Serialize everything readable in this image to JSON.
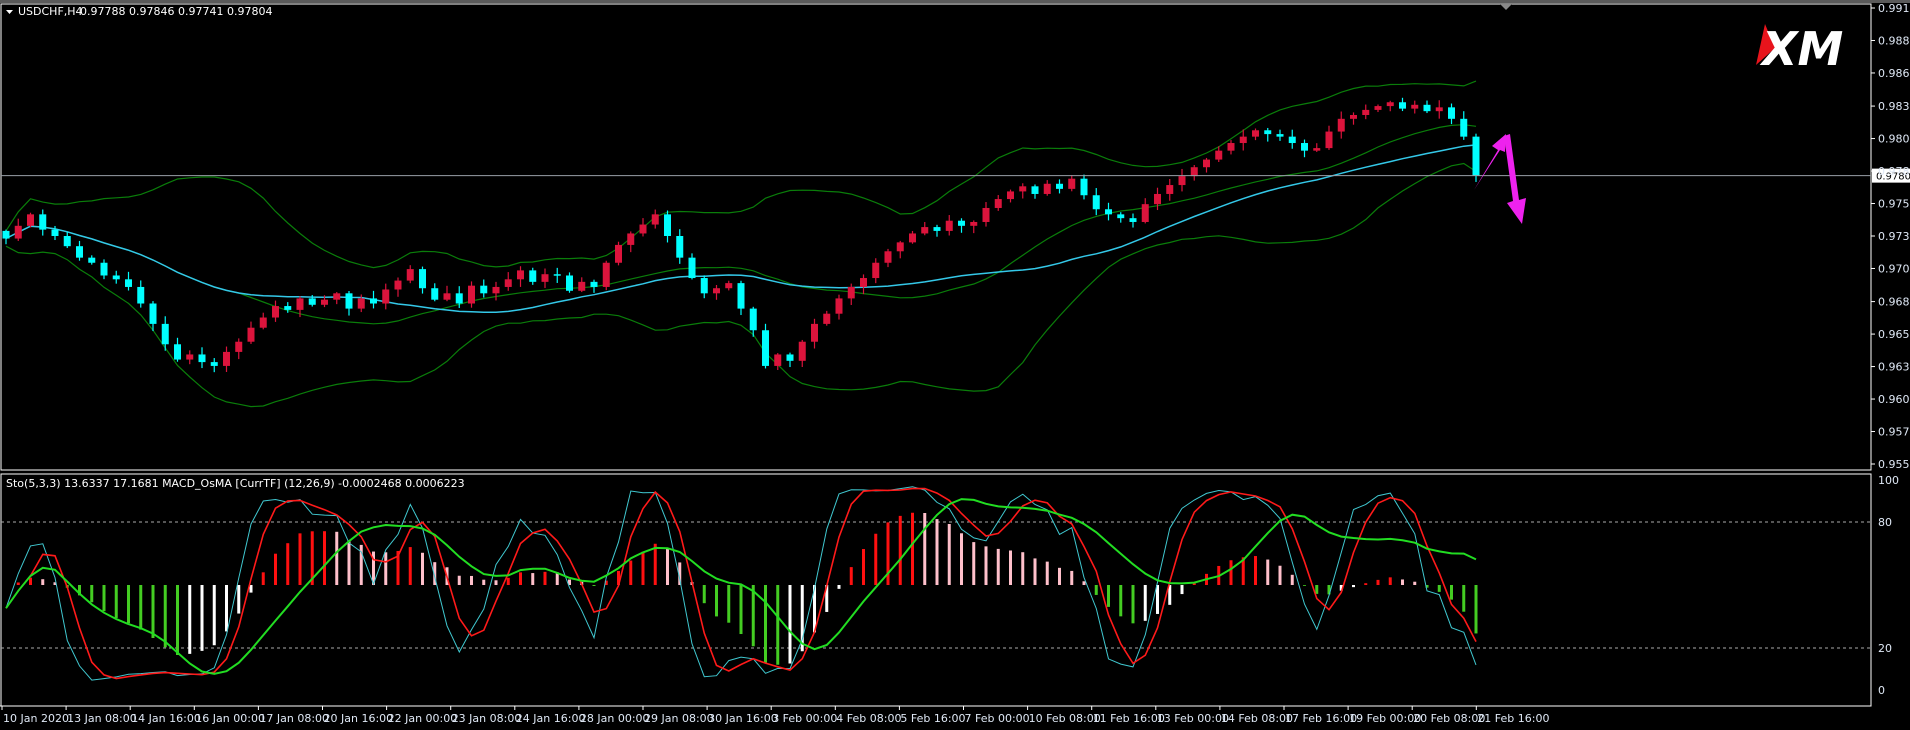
{
  "header": {
    "symbol": "USDCHF,H4",
    "ohlc": "0.97788 0.97846 0.97741 0.97804"
  },
  "subwindow": {
    "label": "Sto(5,3,3) 13.6337 17.1681  MACD_OsMA [CurrTF] (12,26,9) -0.0002468 0.0006223",
    "levels": [
      "100",
      "80",
      "20",
      "0"
    ]
  },
  "logo": {
    "text": "XM"
  },
  "colors": {
    "background": "#000000",
    "bull": "#dc143c",
    "bear": "#00ffff",
    "bands": "#0a7d0a",
    "ma": "#34c8e8",
    "arrow": "#ee22ee",
    "stoch_main": "#40c8d0",
    "stoch_signal": "#ff1a1a",
    "stoch_slow": "#22dd22"
  },
  "chart_data": {
    "type": "candlestick",
    "symbol": "USDCHF",
    "timeframe": "H4",
    "current_price": "0.97804",
    "price_axis": [
      "0.99120",
      "0.98865",
      "0.98610",
      "0.98350",
      "0.98095",
      "0.97840",
      "0.97585",
      "0.97330",
      "0.97075",
      "0.96815",
      "0.96560",
      "0.96305",
      "0.96050",
      "0.95795",
      "0.95540"
    ],
    "ylim": [
      0.9554,
      0.9912
    ],
    "time_axis": [
      "10 Jan 2020",
      "13 Jan 08:00",
      "14 Jan 16:00",
      "16 Jan 00:00",
      "17 Jan 08:00",
      "20 Jan 16:00",
      "22 Jan 00:00",
      "23 Jan 08:00",
      "24 Jan 16:00",
      "28 Jan 00:00",
      "29 Jan 08:00",
      "30 Jan 16:00",
      "3 Feb 00:00",
      "4 Feb 08:00",
      "5 Feb 16:00",
      "7 Feb 00:00",
      "10 Feb 08:00",
      "11 Feb 16:00",
      "13 Feb 00:00",
      "14 Feb 08:00",
      "17 Feb 16:00",
      "19 Feb 00:00",
      "20 Feb 08:00",
      "21 Feb 16:00"
    ],
    "closes": [
      0.9731,
      0.9741,
      0.975,
      0.9738,
      0.9733,
      0.9725,
      0.9716,
      0.9712,
      0.9702,
      0.9699,
      0.9693,
      0.968,
      0.9664,
      0.9648,
      0.9636,
      0.964,
      0.9634,
      0.9631,
      0.9642,
      0.965,
      0.9661,
      0.9669,
      0.9678,
      0.9675,
      0.9684,
      0.9679,
      0.9683,
      0.9688,
      0.9676,
      0.9684,
      0.968,
      0.9691,
      0.9698,
      0.9707,
      0.9692,
      0.9683,
      0.9688,
      0.968,
      0.9694,
      0.9688,
      0.9693,
      0.9699,
      0.9706,
      0.9697,
      0.9703,
      0.9702,
      0.969,
      0.9697,
      0.9693,
      0.9712,
      0.9726,
      0.9735,
      0.9742,
      0.975,
      0.9733,
      0.9716,
      0.97,
      0.9688,
      0.9692,
      0.9696,
      0.9676,
      0.9659,
      0.9631,
      0.964,
      0.9635,
      0.965,
      0.9664,
      0.9672,
      0.9684,
      0.9693,
      0.97,
      0.9712,
      0.9721,
      0.9728,
      0.9735,
      0.974,
      0.9737,
      0.9745,
      0.9741,
      0.9744,
      0.9755,
      0.9762,
      0.9768,
      0.9772,
      0.9766,
      0.9774,
      0.977,
      0.9778,
      0.9765,
      0.9754,
      0.975,
      0.9747,
      0.9744,
      0.9758,
      0.9766,
      0.9773,
      0.978,
      0.9787,
      0.9793,
      0.98,
      0.9806,
      0.9811,
      0.9816,
      0.9813,
      0.9811,
      0.9806,
      0.98,
      0.9802,
      0.9815,
      0.9825,
      0.9828,
      0.9832,
      0.9835,
      0.9838,
      0.9833,
      0.9836,
      0.9831,
      0.9834,
      0.9825,
      0.9811,
      0.97804
    ],
    "indicators": [
      "Bollinger Bands (20,2)",
      "Moving Average",
      "Sto(5,3,3)",
      "MACD_OsMA (12,26,9)"
    ]
  }
}
